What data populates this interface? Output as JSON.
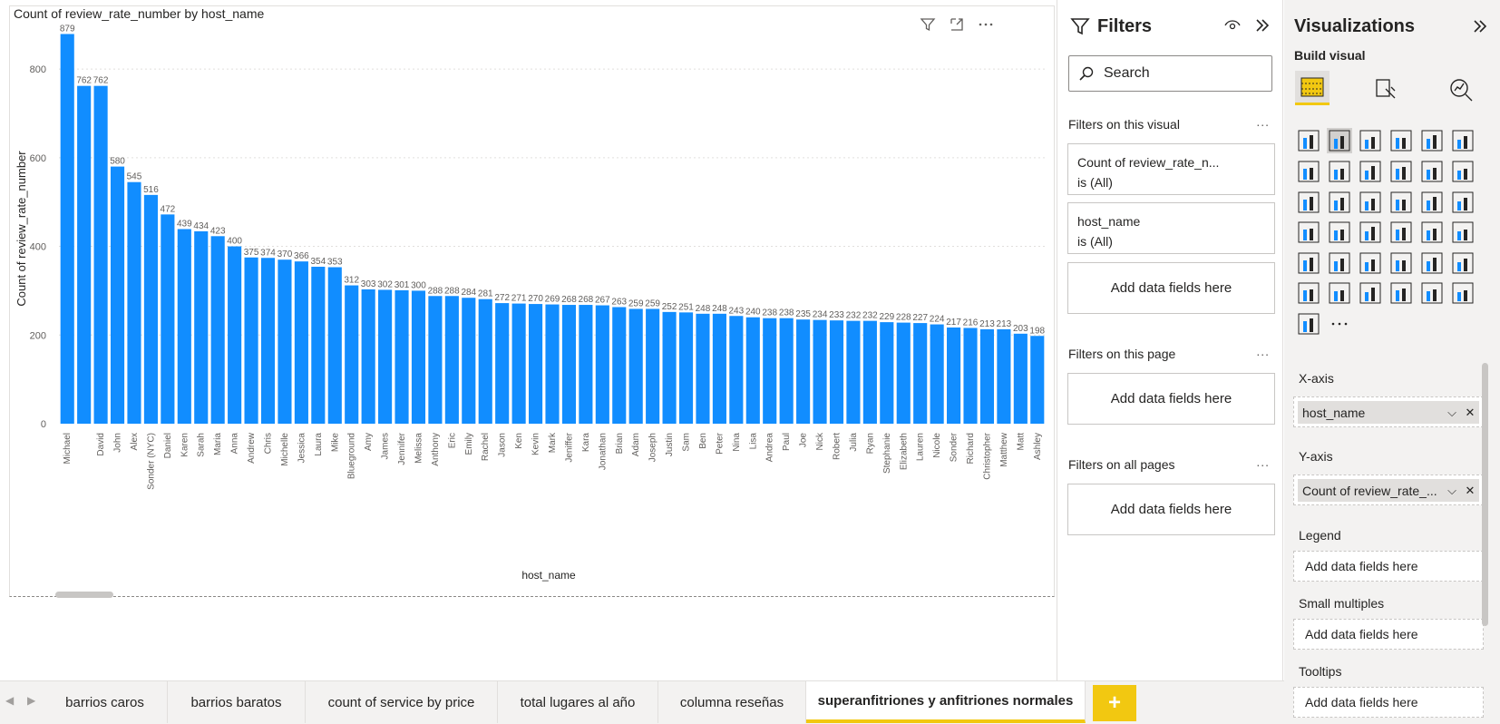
{
  "visual": {
    "title": "Count of review_rate_number by host_name",
    "header_icons": [
      "filter-icon",
      "focus-mode-icon",
      "more-options-icon"
    ]
  },
  "chart_data": {
    "type": "bar",
    "title": "Count of review_rate_number by host_name",
    "xlabel": "host_name",
    "ylabel": "Count of review_rate_number",
    "ylim": [
      0,
      880
    ],
    "yticks": [
      0,
      200,
      400,
      600,
      800
    ],
    "grid": true,
    "color": "#118DFF",
    "categories": [
      "Michael",
      "",
      "David",
      "John",
      "Alex",
      "Sonder (NYC)",
      "Daniel",
      "Karen",
      "Sarah",
      "Maria",
      "Anna",
      "Andrew",
      "Chris",
      "Michelle",
      "Jessica",
      "Laura",
      "Mike",
      "Blueground",
      "Amy",
      "James",
      "Jennifer",
      "Melissa",
      "Anthony",
      "Eric",
      "Emily",
      "Rachel",
      "Jason",
      "Ken",
      "Kevin",
      "Mark",
      "Jeniffer",
      "Kara",
      "Jonathan",
      "Brian",
      "Adam",
      "Joseph",
      "Justin",
      "Sam",
      "Ben",
      "Peter",
      "Nina",
      "Lisa",
      "Andrea",
      "Paul",
      "Joe",
      "Nick",
      "Robert",
      "Julia",
      "Ryan",
      "Stephanie",
      "Elizabeth",
      "Lauren",
      "Nicole",
      "Sonder",
      "Richard",
      "Christopher",
      "Matthew",
      "Matt",
      "Ashley"
    ],
    "values": [
      879,
      762,
      762,
      580,
      545,
      516,
      472,
      439,
      434,
      423,
      400,
      375,
      374,
      370,
      366,
      354,
      353,
      312,
      303,
      302,
      301,
      300,
      288,
      288,
      284,
      281,
      272,
      271,
      270,
      269,
      268,
      268,
      267,
      263,
      259,
      259,
      252,
      251,
      248,
      248,
      243,
      240,
      238,
      238,
      235,
      234,
      233,
      232,
      232,
      229,
      228,
      227,
      224,
      217,
      216,
      213,
      213,
      203,
      198
    ]
  },
  "filters": {
    "title": "Filters",
    "search_placeholder": "Search",
    "on_visual_label": "Filters on this visual",
    "cards": [
      {
        "field": "Count of review_rate_n...",
        "condition": "is (All)"
      },
      {
        "field": "host_name",
        "condition": "is (All)"
      }
    ],
    "add_fields": "Add data fields here",
    "on_page_label": "Filters on this page",
    "on_all_pages_label": "Filters on all pages",
    "ellipsis": "..."
  },
  "visualizations": {
    "title": "Visualizations",
    "build_visual": "Build visual",
    "more": "...",
    "x_axis_label": "X-axis",
    "x_axis_field": "host_name",
    "y_axis_label": "Y-axis",
    "y_axis_field": "Count of review_rate_...",
    "legend_label": "Legend",
    "small_multiples_label": "Small multiples",
    "tooltips_label": "Tooltips",
    "add_fields": "Add data fields here"
  },
  "tabs": [
    {
      "label": "barrios caros",
      "active": false
    },
    {
      "label": "barrios baratos",
      "active": false
    },
    {
      "label": "count of service by price",
      "active": false
    },
    {
      "label": "total lugares al año",
      "active": false
    },
    {
      "label": "columna reseñas",
      "active": false
    },
    {
      "label": "superanfitriones y anfitriones normales",
      "active": true
    }
  ],
  "add_page": "+"
}
